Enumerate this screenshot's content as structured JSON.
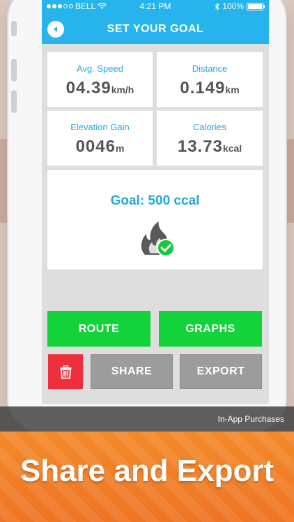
{
  "status_bar": {
    "carrier": "BELL",
    "time": "4:21 PM",
    "battery": "100%"
  },
  "nav": {
    "title": "SET YOUR GOAL"
  },
  "stats": [
    {
      "label": "Avg. Speed",
      "value": "04.39",
      "unit": "km/h"
    },
    {
      "label": "Distance",
      "value": "0.149",
      "unit": "km"
    },
    {
      "label": "Elevation Gain",
      "value": "0046",
      "unit": "m"
    },
    {
      "label": "Calories",
      "value": "13.73",
      "unit": "kcal"
    }
  ],
  "goal": {
    "text": "Goal: 500 ccal"
  },
  "buttons": {
    "route": "ROUTE",
    "graphs": "GRAPHS",
    "share": "SHARE",
    "export": "EXPORT"
  },
  "iap": {
    "label": "In-App Purchases"
  },
  "banner": {
    "caption": "Share and Export"
  },
  "colors": {
    "accent": "#27b4ec",
    "green": "#13d23a",
    "red": "#ee2f3c",
    "gray": "#9c9c9c",
    "banner": "#f07d28"
  }
}
